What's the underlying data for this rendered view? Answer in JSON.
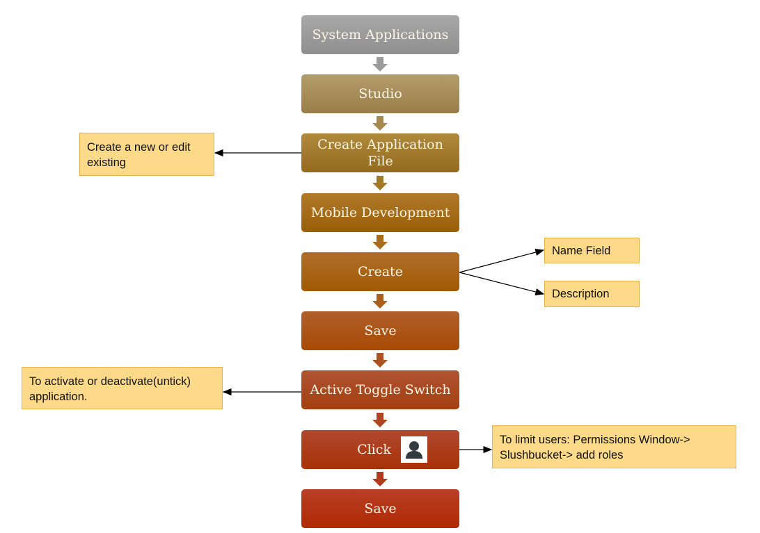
{
  "steps": [
    {
      "label": "System Applications",
      "color_top": "#a8a8a8",
      "color_bottom": "#8f8f8f"
    },
    {
      "label": "Studio",
      "color_top": "#b49c6c",
      "color_bottom": "#9a7e48"
    },
    {
      "label": "Create Application File",
      "color_top": "#b08a3c",
      "color_bottom": "#946a1e"
    },
    {
      "label": "Mobile Development",
      "color_top": "#b07a2a",
      "color_bottom": "#9a5e08"
    },
    {
      "label": "Create",
      "color_top": "#b06e2a",
      "color_bottom": "#a25a02"
    },
    {
      "label": "Save",
      "color_top": "#b0602c",
      "color_bottom": "#a84a04"
    },
    {
      "label": "Active Toggle Switch",
      "color_top": "#b05434",
      "color_bottom": "#a43e0e"
    },
    {
      "label": "Click",
      "icon": "user-icon",
      "color_top": "#b0482e",
      "color_bottom": "#a83208"
    },
    {
      "label": "Save",
      "color_top": "#b83e26",
      "color_bottom": "#b02a02"
    }
  ],
  "notes": {
    "create_app_file": "Create a new or edit existing",
    "name_field": "Name Field",
    "description": "Description",
    "toggle": "To activate or deactivate(untick) application.",
    "permissions": "To limit users: Permissions Window-> Slushbucket-> add roles"
  },
  "colors": {
    "note_fill": "#fdd98a",
    "note_border": "#e8b24a",
    "connector": "#000000"
  }
}
